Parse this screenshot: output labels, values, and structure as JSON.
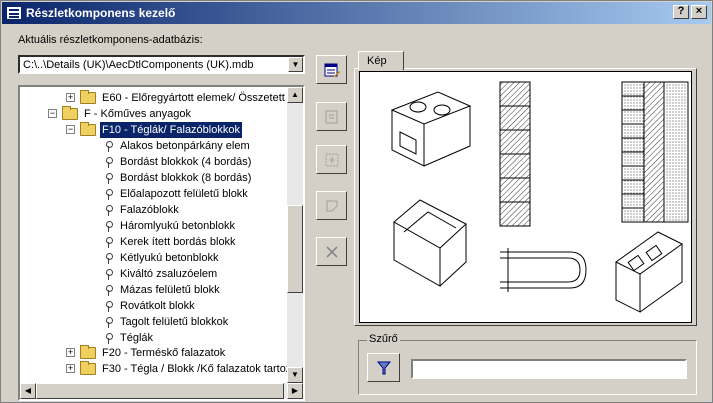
{
  "window": {
    "title": "Részletkomponens kezelő",
    "help_label": "?",
    "close_label": "×"
  },
  "database": {
    "label": "Aktuális részletkomponens-adatbázis:",
    "value": "C:\\..\\Details (UK)\\AecDtlComponents (UK).mdb"
  },
  "tree": {
    "top_item": "E60 - Előregyártott elemek/ Összetett be",
    "f_item": "F - Kőműves anyagok",
    "f10_item": "F10 - Téglák/ Falazóblokkok",
    "children": [
      "Alakos betonpárkány elem",
      "Bordást blokkok (4 bordás)",
      "Bordást blokkok (8 bordás)",
      "Előalapozott felületű blokk",
      "Falazóblokk",
      "Háromlyukú betonblokk",
      "Kerek ített bordás blokk",
      "Kétlyukú betonblokk",
      "Kiváltó zsaluzóelem",
      "Mázas felületű blokk",
      "Rovátkolt blokk",
      "Tagolt felületű blokkok",
      "Téglák"
    ],
    "f20_item": "F20 - Terméskő falazatok",
    "f30_item": "F30 - Tégla / Blokk /Kő falazatok tartoz"
  },
  "preview": {
    "tab_label": "Kép"
  },
  "filter": {
    "label": "Szűrő",
    "value": ""
  },
  "colors": {
    "title_start": "#0a246a",
    "title_end": "#a6caf0",
    "selection": "#0a246a",
    "folder": "#f0d060"
  }
}
